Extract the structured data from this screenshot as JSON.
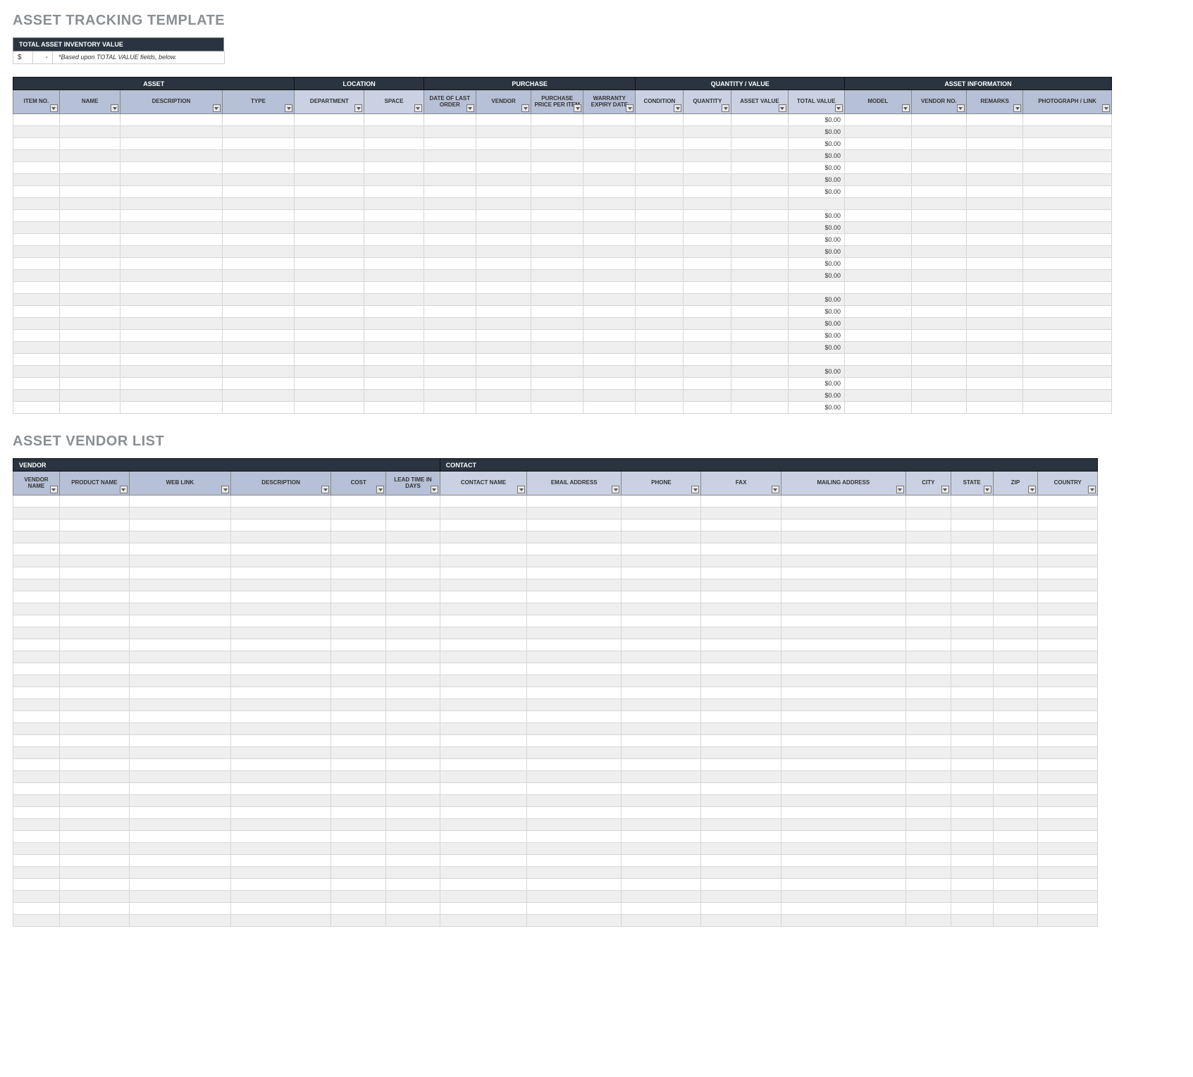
{
  "titles": {
    "asset_tracking": "ASSET TRACKING TEMPLATE",
    "asset_vendor": "ASSET VENDOR LIST"
  },
  "summary": {
    "header": "TOTAL ASSET INVENTORY VALUE",
    "currency": "$",
    "dash": "-",
    "note": "*Based upon TOTAL VALUE fields, below."
  },
  "asset_table": {
    "sections": {
      "asset": "ASSET",
      "location": "LOCATION",
      "purchase": "PURCHASE",
      "quantity_value": "QUANTITY / VALUE",
      "asset_info": "ASSET INFORMATION"
    },
    "columns": {
      "item_no": "ITEM NO.",
      "name": "NAME",
      "description": "DESCRIPTION",
      "type": "TYPE",
      "department": "DEPARTMENT",
      "space": "SPACE",
      "date_last_order": "DATE OF LAST ORDER",
      "vendor": "VENDOR",
      "purchase_price_per_item": "PURCHASE PRICE PER ITEM",
      "warranty_expiry": "WARRANTY EXPIRY DATE",
      "condition": "CONDITION",
      "quantity": "QUANTITY",
      "asset_value": "ASSET VALUE",
      "total_value": "TOTAL VALUE",
      "model": "MODEL",
      "vendor_no": "VENDOR NO.",
      "remarks": "REMARKS",
      "photo_link": "PHOTOGRAPH / LINK"
    },
    "row_count": 25,
    "total_value_rows": [
      "$0.00",
      "$0.00",
      "$0.00",
      "$0.00",
      "$0.00",
      "$0.00",
      "$0.00",
      "",
      "$0.00",
      "$0.00",
      "$0.00",
      "$0.00",
      "$0.00",
      "$0.00",
      "",
      "$0.00",
      "$0.00",
      "$0.00",
      "$0.00",
      "$0.00",
      "",
      "$0.00",
      "$0.00",
      "$0.00",
      "$0.00"
    ]
  },
  "vendor_table": {
    "sections": {
      "vendor": "VENDOR",
      "contact": "CONTACT"
    },
    "columns": {
      "vendor_name": "VENDOR NAME",
      "product_name": "PRODUCT NAME",
      "web_link": "WEB LINK",
      "description": "DESCRIPTION",
      "cost": "COST",
      "lead_time": "LEAD TIME IN DAYS",
      "contact_name": "CONTACT NAME",
      "email": "EMAIL ADDRESS",
      "phone": "PHONE",
      "fax": "FAX",
      "mailing": "MAILING ADDRESS",
      "city": "CITY",
      "state": "STATE",
      "zip": "ZIP",
      "country": "COUNTRY"
    },
    "row_count": 36
  }
}
